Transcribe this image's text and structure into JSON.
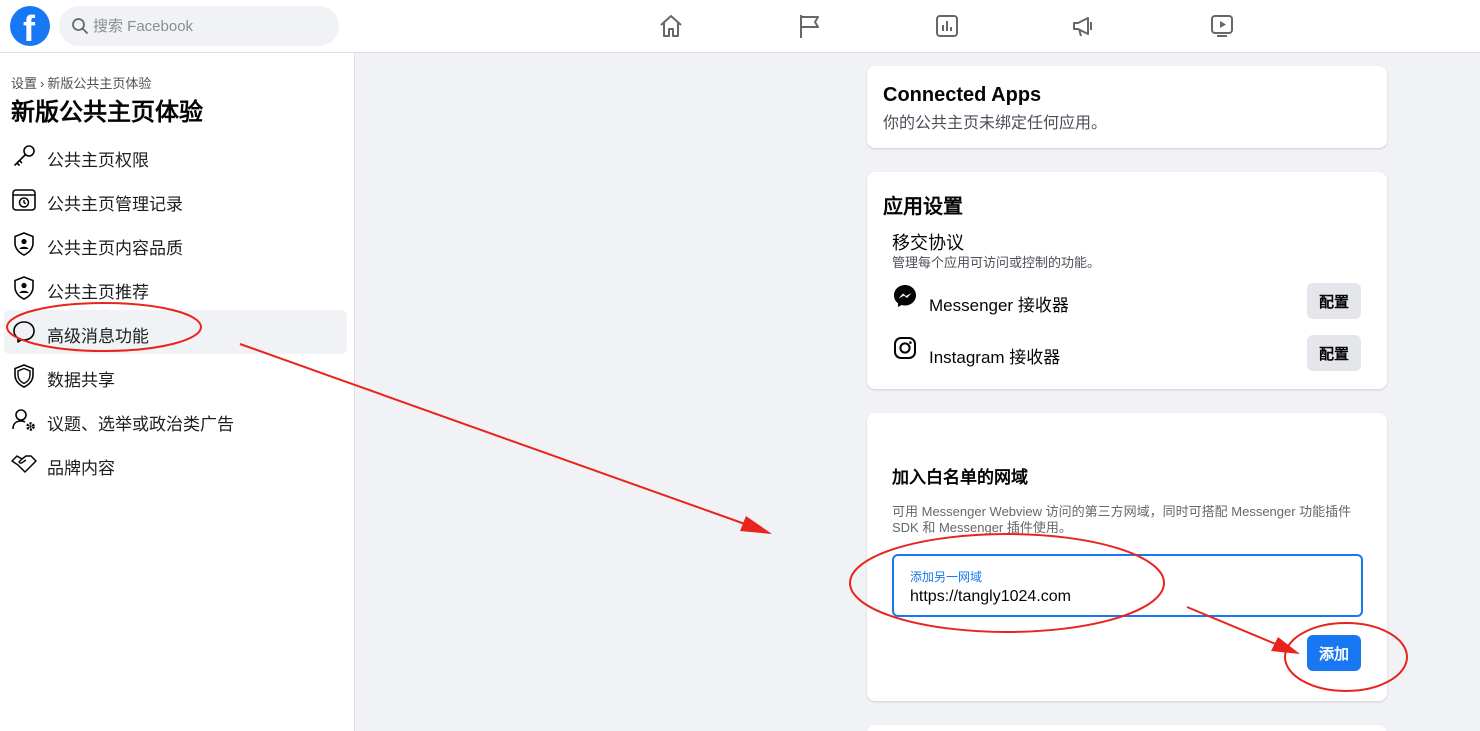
{
  "topbar": {
    "logo_letter": "f",
    "search_placeholder": "搜索 Facebook"
  },
  "sidebar": {
    "breadcrumb": [
      "设置",
      "新版公共主页体验"
    ],
    "breadcrumb_sep": "›",
    "title": "新版公共主页体验",
    "items": [
      {
        "label": "公共主页权限",
        "icon": "key-icon"
      },
      {
        "label": "公共主页管理记录",
        "icon": "history-icon"
      },
      {
        "label": "公共主页内容品质",
        "icon": "shield-person-icon"
      },
      {
        "label": "公共主页推荐",
        "icon": "shield-person-icon"
      },
      {
        "label": "高级消息功能",
        "icon": "chat-bubble-icon",
        "active": true
      },
      {
        "label": "数据共享",
        "icon": "shield-icon"
      },
      {
        "label": "议题、选举或政治类广告",
        "icon": "person-gear-icon"
      },
      {
        "label": "品牌内容",
        "icon": "handshake-icon"
      }
    ]
  },
  "connected_apps": {
    "title": "Connected Apps",
    "subtitle": "你的公共主页未绑定任何应用。"
  },
  "app_settings": {
    "title": "应用设置",
    "handover_title": "移交协议",
    "handover_desc": "管理每个应用可访问或控制的功能。",
    "rows": [
      {
        "label": "Messenger 接收器",
        "icon": "messenger-icon",
        "button": "配置"
      },
      {
        "label": "Instagram 接收器",
        "icon": "instagram-icon",
        "button": "配置"
      }
    ]
  },
  "whitelist": {
    "title": "加入白名单的网域",
    "desc": "可用 Messenger Webview 访问的第三方网域，同时可搭配 Messenger 功能插件 SDK 和 Messenger 插件使用。",
    "field_label": "添加另一网域",
    "field_value": "https://tangly1024.com",
    "add_button": "添加"
  },
  "colors": {
    "brand": "#1877f2",
    "annotation": "#e8241c"
  }
}
